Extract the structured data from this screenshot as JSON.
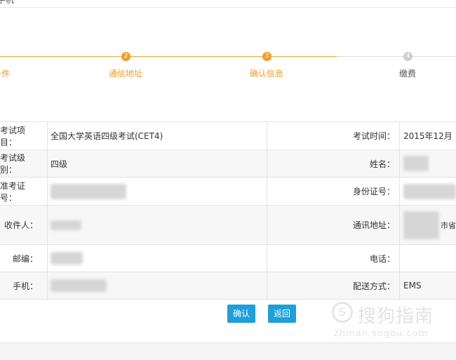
{
  "breadcrumb": "手机",
  "steps": [
    {
      "label": "条件"
    },
    {
      "number": "2",
      "label": "通信地址"
    },
    {
      "number": "3",
      "label": "确认信息"
    },
    {
      "number": "4",
      "label": "缴费"
    }
  ],
  "info": {
    "exam_item_label": "考试项目：",
    "exam_item_value": "全国大学英语四级考试(CET4)",
    "exam_time_label": "考试时间：",
    "exam_time_value": "2015年12月",
    "exam_level_label": "考试级别：",
    "exam_level_value": "四级",
    "name_label": "姓名：",
    "ticket_label": "准考证号：",
    "id_label": "身份证号：",
    "recipient_label": "收件人：",
    "address_label": "通讯地址：",
    "address_partial": "市省",
    "postcode_label": "邮编：",
    "phone_label": "电话：",
    "mobile_label": "手机：",
    "delivery_label": "配送方式：",
    "delivery_value": "EMS"
  },
  "actions": {
    "confirm": "确认",
    "back": "返回"
  },
  "watermark": {
    "icon": "S",
    "text": "搜狗指南",
    "sub": "zhinan.sogou.com"
  },
  "colors": {
    "accent": "#f39c2c",
    "button": "#1e9fda",
    "inactive": "#cfcfcf"
  }
}
